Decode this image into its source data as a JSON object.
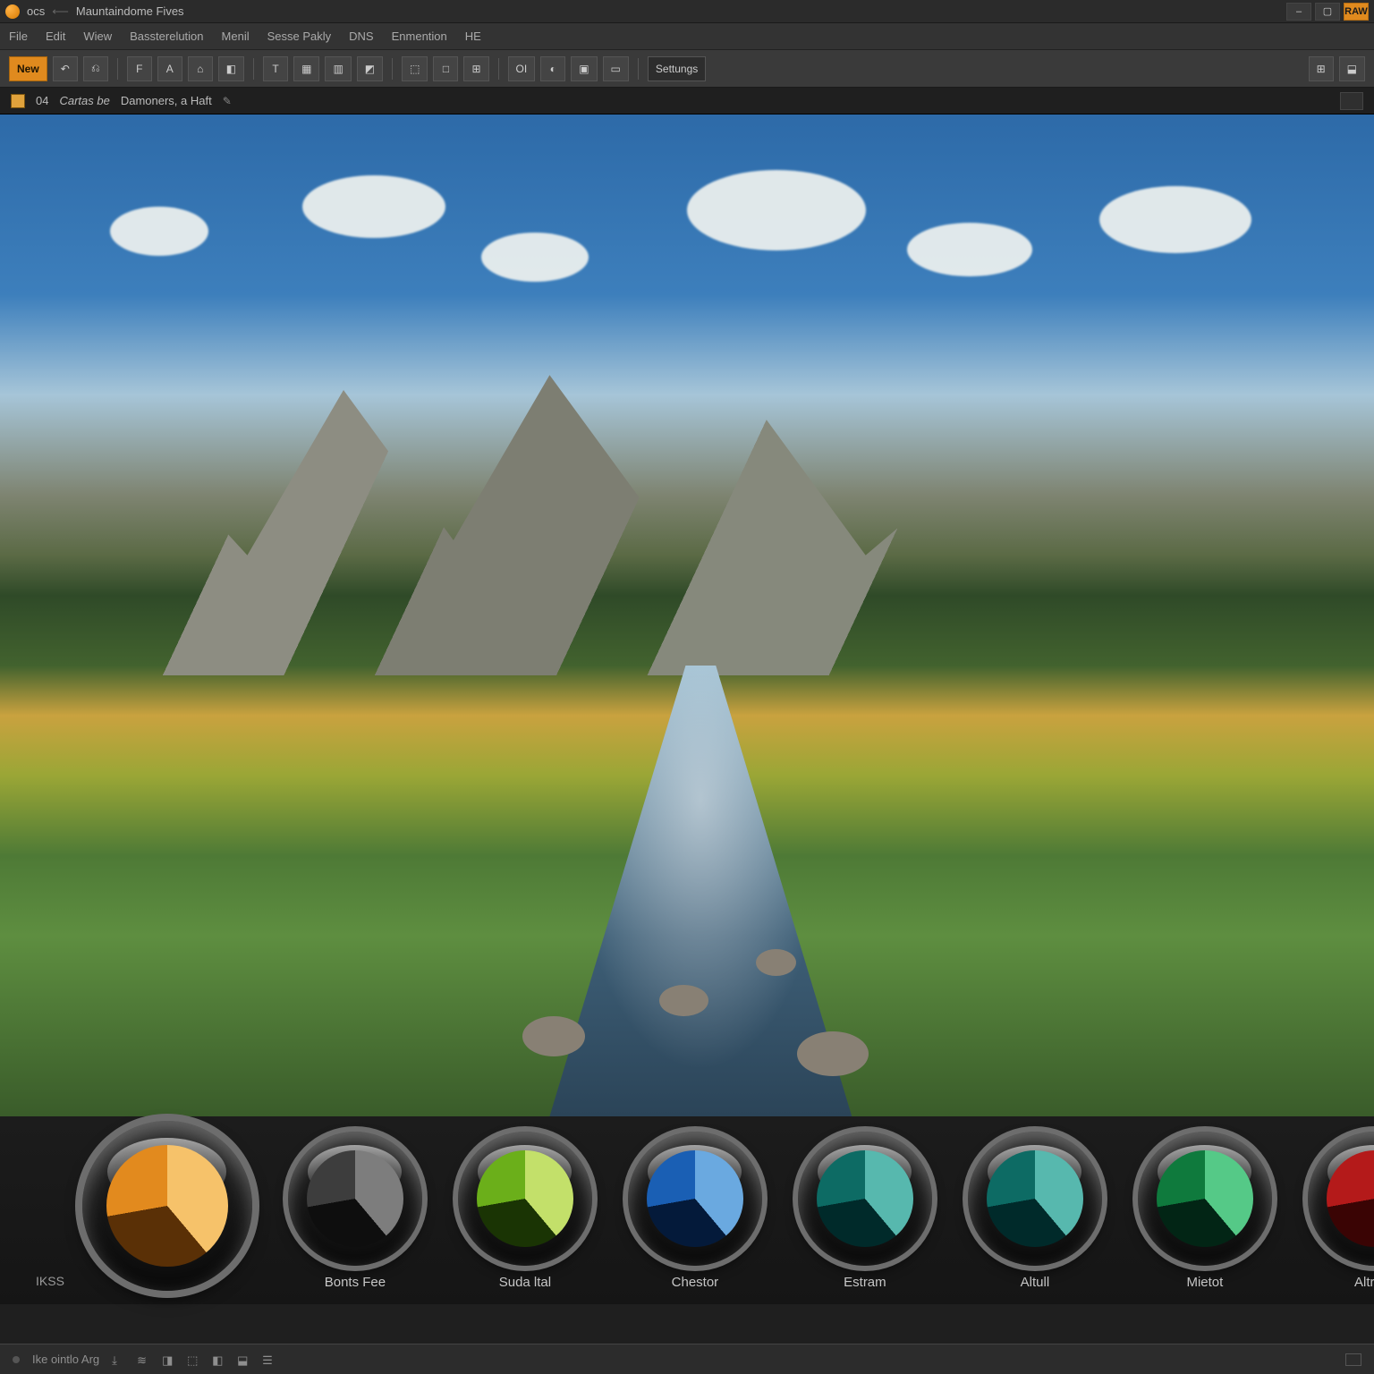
{
  "title": {
    "app": "ocs",
    "doc": "Mauntaindome  Fives"
  },
  "window_buttons": [
    "–",
    "▢",
    "RAW"
  ],
  "menu": [
    "File",
    "Edit",
    "Wiew",
    "Bassterelution",
    "Menil",
    "Sesse Pakly",
    "DNS",
    "Enmention",
    "HE"
  ],
  "toolbar": {
    "new_label": "New",
    "items": [
      "↶",
      "⎌",
      "F",
      "A",
      "⌂",
      "◧",
      "T",
      "▦",
      "▥",
      "◩",
      "⬚",
      "□",
      "⊞",
      "OI",
      "◐",
      "▣",
      "▭"
    ],
    "settings_label": "Settungs",
    "right": [
      "⊞",
      "⬓"
    ]
  },
  "doctab": {
    "id": "04",
    "name": "Cartas be",
    "meta": "Damoners, a Haft",
    "edit_icon": "✎"
  },
  "filters": {
    "left_caption": "IKSS",
    "items": [
      {
        "color": "orange",
        "big": true,
        "label": ""
      },
      {
        "color": "grey",
        "big": false,
        "label": "Bonts Fee"
      },
      {
        "color": "green",
        "big": false,
        "label": "Suda ltal"
      },
      {
        "color": "blue",
        "big": false,
        "label": "Chestor"
      },
      {
        "color": "teal",
        "big": false,
        "label": "Estram"
      },
      {
        "color": "teal",
        "big": false,
        "label": "Altull"
      },
      {
        "color": "emer",
        "big": false,
        "label": "Mietot"
      },
      {
        "color": "red",
        "big": false,
        "label": "Altracs"
      }
    ]
  },
  "status": {
    "left": "Ike ointlo Arg",
    "icons": [
      "⤓",
      "≋",
      "◨",
      "⬚",
      "◧",
      "⬓",
      "☰"
    ]
  }
}
